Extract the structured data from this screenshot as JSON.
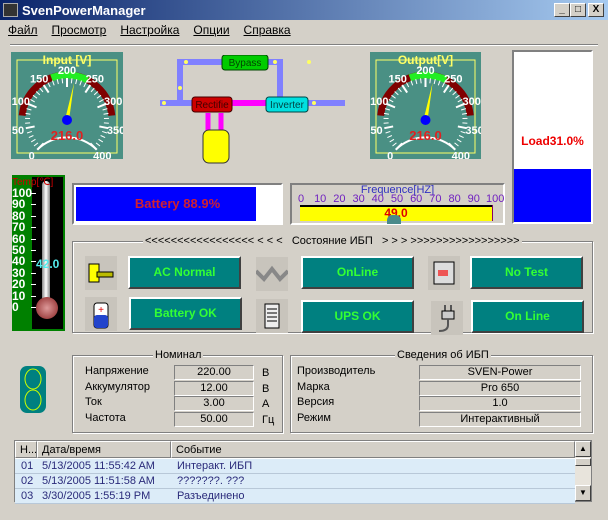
{
  "window": {
    "title": "SvenPowerManager",
    "minimize": "_",
    "maximize": "□",
    "close": "X"
  },
  "menu": [
    "Файл",
    "Просмотр",
    "Настройка",
    "Опции",
    "Справка"
  ],
  "input_gauge": {
    "title": "Input [V]",
    "value": 216.0,
    "display": "216.0",
    "min": 0,
    "max": 400,
    "ticks": [
      "0",
      "50",
      "100",
      "150",
      "200",
      "250",
      "300",
      "350",
      "400"
    ]
  },
  "output_gauge": {
    "title": "Output[V]",
    "value": 216.0,
    "display": "216.0",
    "min": 0,
    "max": 400,
    "ticks": [
      "0",
      "50",
      "100",
      "150",
      "200",
      "250",
      "300",
      "350",
      "400"
    ]
  },
  "diagram": {
    "bypass": "Bypass",
    "rectifier": "Rectifie",
    "inverter": "Inverter"
  },
  "load": {
    "label": "Load31.0%",
    "percent": 31.0
  },
  "temperature": {
    "title": "Temp[℃]",
    "value_display": "42.0",
    "value": 42.0,
    "ticks": [
      "100",
      "90",
      "80",
      "70",
      "60",
      "50",
      "40",
      "30",
      "20",
      "10",
      "0"
    ]
  },
  "battery": {
    "label": "Battery 88.9%",
    "percent": 88.9
  },
  "frequency": {
    "title": "Frequence[HZ]",
    "value_display": "49.0",
    "value": 49.0,
    "ticks": [
      "0",
      "10",
      "20",
      "30",
      "40",
      "50",
      "60",
      "70",
      "80",
      "90",
      "100"
    ]
  },
  "status": {
    "title": "<<<<<<<<<<<<<<<<< < < <   Состояние ИБП   > > > >>>>>>>>>>>>>>>>>",
    "buttons": [
      "AC Normal",
      "OnLine",
      "No Test",
      "Battery OK",
      "UPS OK",
      "On Line"
    ]
  },
  "nominal": {
    "title": "Номинал",
    "rows": [
      {
        "label": "Напряжение",
        "value": "220.00",
        "unit": "В"
      },
      {
        "label": "Аккумулятор",
        "value": "12.00",
        "unit": "В"
      },
      {
        "label": "Ток",
        "value": "3.00",
        "unit": "А"
      },
      {
        "label": "Частота",
        "value": "50.00",
        "unit": "Гц"
      }
    ]
  },
  "ups_info": {
    "title": "Сведения об ИБП",
    "rows": [
      {
        "label": "Производитель",
        "value": "SVEN-Power"
      },
      {
        "label": "Марка",
        "value": "Pro 650"
      },
      {
        "label": "Версия",
        "value": "1.0"
      },
      {
        "label": "Режим",
        "value": "Интерактивный"
      }
    ]
  },
  "log": {
    "columns": [
      "Н...",
      "Дата/время",
      "Событие"
    ],
    "rows": [
      {
        "n": "01",
        "datetime": "5/13/2005 11:55:42 AM",
        "event": "Интеракт. ИБП"
      },
      {
        "n": "02",
        "datetime": "5/13/2005 11:51:58 AM",
        "event": "???????. ???"
      },
      {
        "n": "03",
        "datetime": "3/30/2005 1:55:19 PM",
        "event": "Разъединено"
      }
    ]
  },
  "colors": {
    "panel": "#4a9084",
    "status_button": "#008080",
    "status_text": "#33ff33",
    "bar_blue": "#0000ff",
    "value_red": "#e02020"
  }
}
